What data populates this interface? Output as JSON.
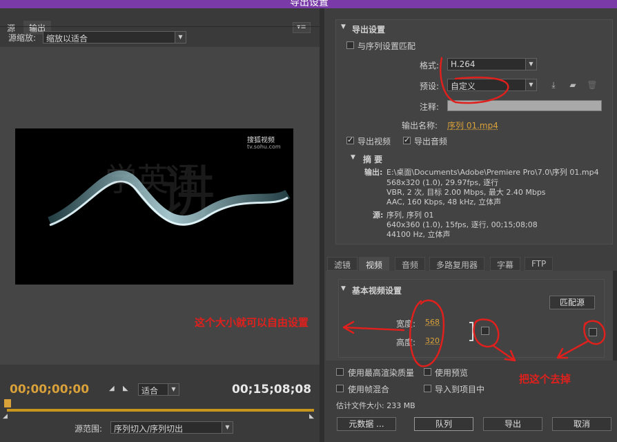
{
  "window": {
    "title": "导出设置"
  },
  "left": {
    "tabs": [
      {
        "label": "源"
      },
      {
        "label": "输出"
      }
    ],
    "menu_icon": "panel-menu-icon",
    "source_scale_label": "源缩放:",
    "source_scale_value": "缩放以适合",
    "watermark_logo": "搜狐视频",
    "watermark_url": "tv.sohu.com",
    "timecode_start": "00;00;00;00",
    "fit_value": "适合",
    "timecode_end": "00;15;08;08",
    "source_range_label": "源范围:",
    "source_range_value": "序列切入/序列切出"
  },
  "right": {
    "export_settings_title": "导出设置",
    "match_sequence_label": "与序列设置匹配",
    "format_label": "格式:",
    "format_value": "H.264",
    "preset_label": "预设:",
    "preset_value": "自定义",
    "comments_label": "注释:",
    "output_name_label": "输出名称:",
    "output_name_value": "序列 01.mp4",
    "export_video_label": "导出视频",
    "export_audio_label": "导出音频",
    "summary_title": "摘 要",
    "output_label": "输出:",
    "output_lines": [
      "E:\\桌面\\Documents\\Adobe\\Premiere Pro\\7.0\\序列 01.mp4",
      "568x320 (1.0), 29.97fps, 逐行",
      "VBR, 2 次, 目标 2.00 Mbps, 最大 2.40 Mbps",
      "AAC, 160 Kbps, 48 kHz, 立体声"
    ],
    "source_label": "源:",
    "source_lines": [
      "序列, 序列 01",
      "640x360 (1.0), 15fps, 逐行, 00;15;08;08",
      "44100 Hz, 立体声"
    ],
    "tabs": [
      {
        "label": "滤镜"
      },
      {
        "label": "视频"
      },
      {
        "label": "音频"
      },
      {
        "label": "多路复用器"
      },
      {
        "label": "字幕"
      },
      {
        "label": "FTP"
      }
    ],
    "basic_video_title": "基本视频设置",
    "match_source_button": "匹配源",
    "width_label": "宽度:",
    "width_value": "568",
    "height_label": "高度:",
    "height_value": "320",
    "max_render_label": "使用最高渲染质量",
    "use_preview_label": "使用预览",
    "frame_blend_label": "使用帧混合",
    "import_project_label": "导入到项目中",
    "file_size_label": "估计文件大小: 233 MB",
    "metadata_button": "元数据 ...",
    "queue_button": "队列",
    "export_button": "导出",
    "cancel_button": "取消"
  },
  "annotations": {
    "size_note": "这个大小就可以自由设置",
    "remove_note": "把这个去掉"
  },
  "icons": {
    "save_preset": "save-preset-icon",
    "import_preset": "import-preset-icon",
    "delete_preset": "delete-preset-icon"
  },
  "colors": {
    "accent_orange": "#d9a13a",
    "title_purple": "#7a3aa8",
    "annotation_red": "#e0201c"
  }
}
